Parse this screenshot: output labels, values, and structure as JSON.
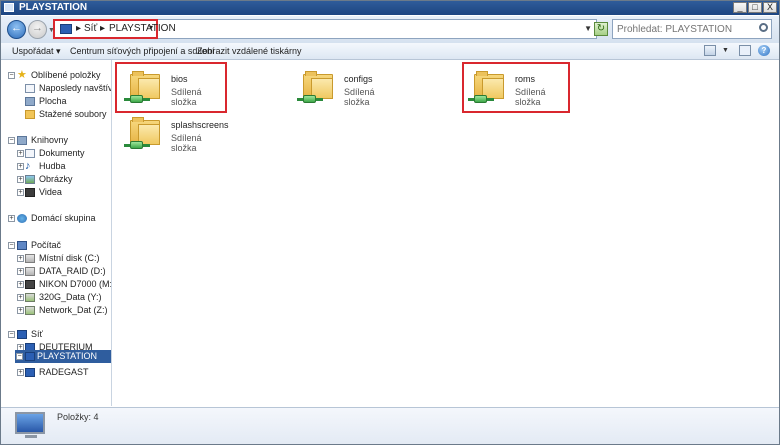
{
  "window": {
    "title": "PLAYSTATION",
    "controls": {
      "minimize": "_",
      "maximize": "□",
      "close": "X"
    }
  },
  "address": {
    "crumbs": [
      "Síť",
      "PLAYSTATION"
    ],
    "search_placeholder": "Prohledat: PLAYSTATION"
  },
  "toolbar": {
    "organize": "Uspořádat",
    "network_center": "Centrum síťových připojení a sdílení",
    "show_printers": "Zobrazit vzdálené tiskárny"
  },
  "nav": {
    "favorites": {
      "label": "Oblíbené položky",
      "items": [
        "Naposledy navštívené",
        "Plocha",
        "Stažené soubory"
      ]
    },
    "libraries": {
      "label": "Knihovny",
      "items": [
        "Dokumenty",
        "Hudba",
        "Obrázky",
        "Videa"
      ]
    },
    "homegroup": "Domácí skupina",
    "computer": {
      "label": "Počítač",
      "items": [
        "Místní disk (C:)",
        "DATA_RAID (D:)",
        "NIKON D7000 (M:)",
        "320G_Data (Y:)",
        "Network_Dat (Z:)"
      ]
    },
    "network": {
      "label": "Síť",
      "items": [
        "DEUTERIUM",
        "PLAYSTATION",
        "RADEGAST"
      ],
      "selected": "PLAYSTATION"
    }
  },
  "folders": [
    {
      "name": "bios",
      "type": "Sdílená složka",
      "highlighted": true
    },
    {
      "name": "configs",
      "type": "Sdílená složka",
      "highlighted": false
    },
    {
      "name": "roms",
      "type": "Sdílená složka",
      "highlighted": true
    },
    {
      "name": "splashscreens",
      "type": "Sdílená složka",
      "highlighted": false
    }
  ],
  "details": {
    "count": "Položky: 4"
  },
  "colors": {
    "highlight": "#d9272e",
    "selection": "#2f5d9e",
    "title_bar": "#2f5c9a"
  },
  "icons": {
    "back": "back-arrow-icon",
    "forward": "forward-arrow-icon",
    "refresh": "refresh-icon",
    "search": "search-icon",
    "help": "help-icon"
  }
}
